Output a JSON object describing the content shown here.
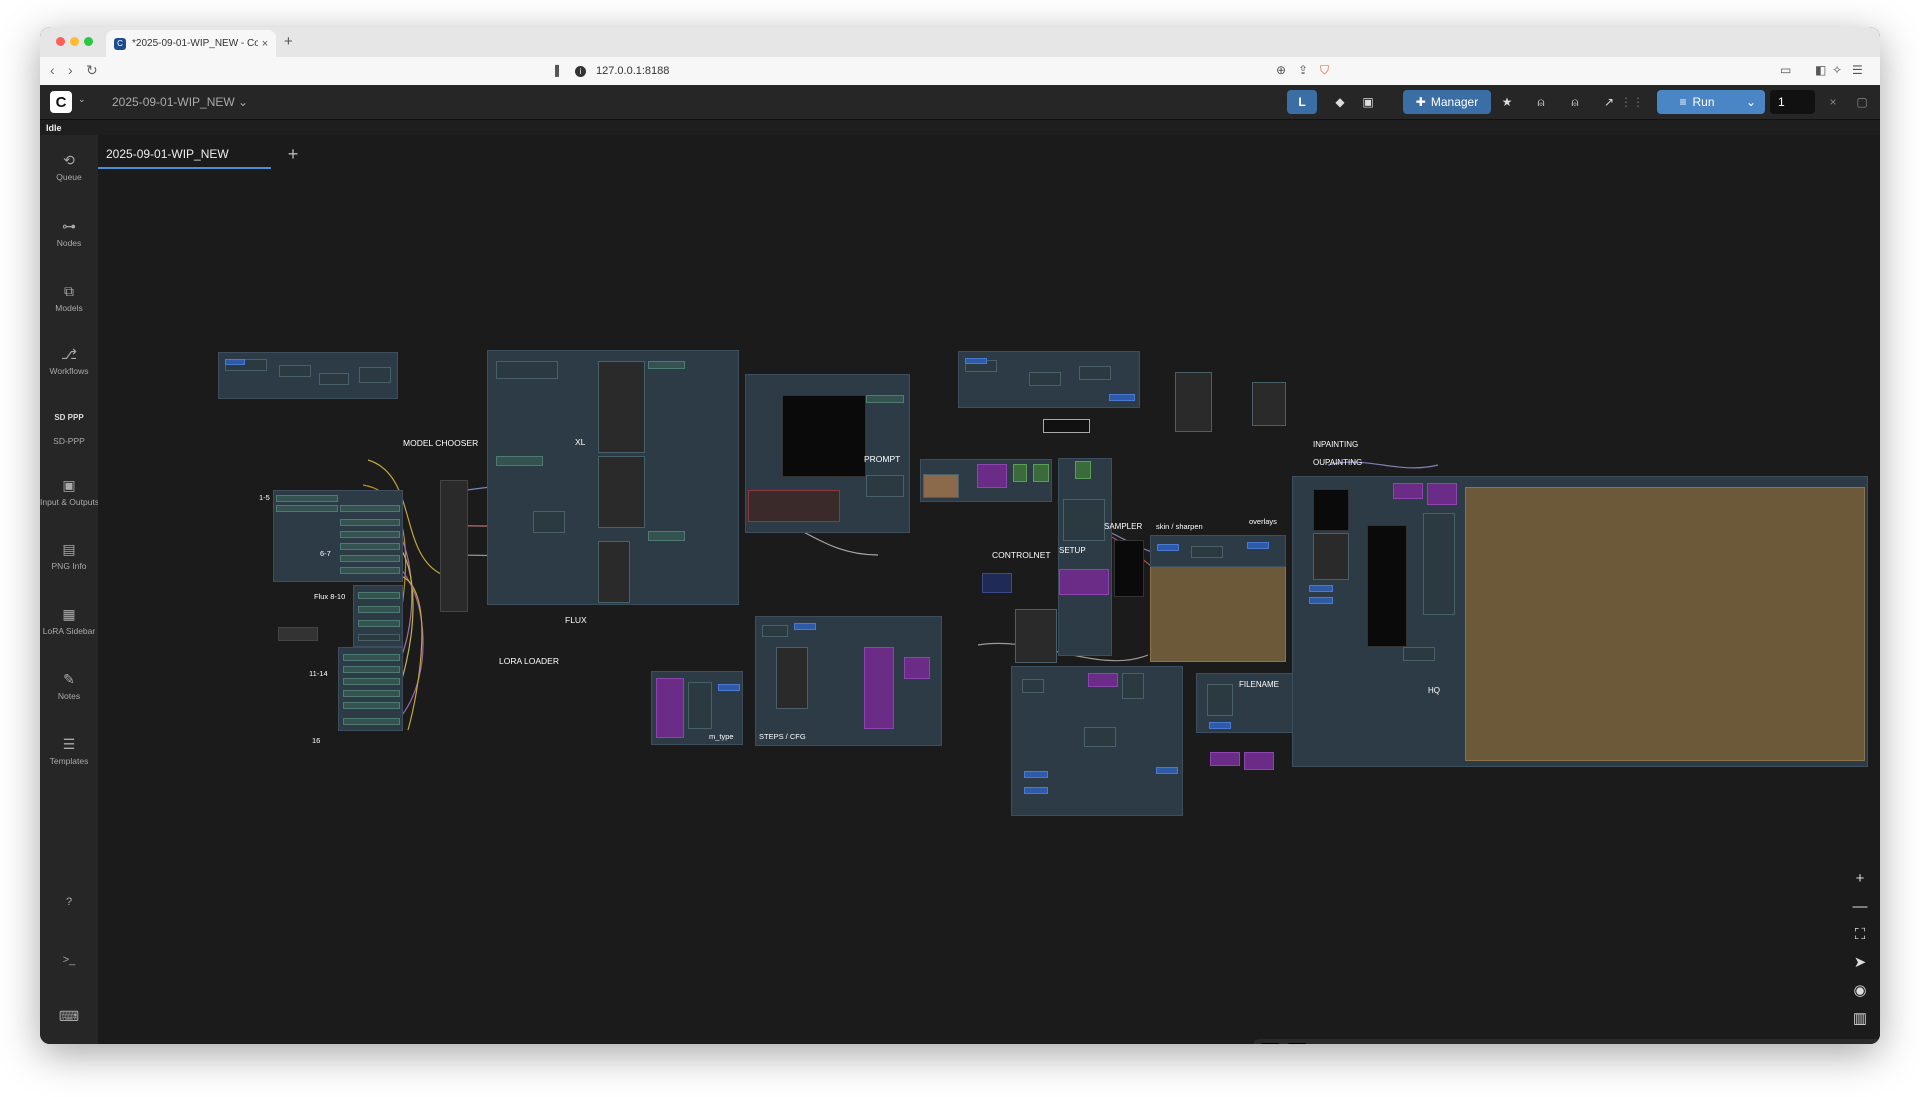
{
  "browser": {
    "tab_title": "*2025-09-01-WIP_NEW - Co",
    "tab_close": "×",
    "new_tab": "+",
    "url": "127.0.0.1:8188",
    "nav": {
      "back": "‹",
      "forward": "›",
      "reload": "↻"
    }
  },
  "app": {
    "logo": "C",
    "workflow_name": "2025-09-01-WIP_NEW ⌄",
    "status": "Idle",
    "toolbar": {
      "layout_badge": "L",
      "manager_label": "Manager",
      "run_label": "Run",
      "batch_count": "1",
      "close": "×"
    }
  },
  "sidebar": {
    "items": [
      {
        "label": "Queue",
        "icon": "history-icon",
        "glyph": "⟲"
      },
      {
        "label": "Nodes",
        "icon": "nodes-icon",
        "glyph": "⊶"
      },
      {
        "label": "Models",
        "icon": "models-icon",
        "glyph": "⧉"
      },
      {
        "label": "Workflows",
        "icon": "workflows-icon",
        "glyph": "⎇"
      },
      {
        "label": "SD-PPP",
        "icon": "sd-ppp-logo",
        "glyph": "SD PPP"
      },
      {
        "label": "Input & Outputs",
        "icon": "image-icon",
        "glyph": "▣"
      },
      {
        "label": "PNG Info",
        "icon": "png-info-icon",
        "glyph": "▤"
      },
      {
        "label": "LoRA Sidebar",
        "icon": "lora-icon",
        "glyph": "▦"
      },
      {
        "label": "Notes",
        "icon": "notes-icon",
        "glyph": "✎"
      },
      {
        "label": "Templates",
        "icon": "templates-icon",
        "glyph": "☰"
      }
    ],
    "bottom": [
      {
        "icon": "help-icon",
        "glyph": "?"
      },
      {
        "icon": "terminal-icon",
        "glyph": ">_"
      },
      {
        "icon": "keyboard-icon",
        "glyph": "⌨"
      }
    ]
  },
  "canvas": {
    "workflow_tab": "2025-09-01-WIP_NEW",
    "add_tab": "+",
    "group_labels": {
      "model_chooser": "MODEL CHOOSER",
      "xl": "XL",
      "g1_5": "1-5",
      "g6_7": "6-7",
      "flux_8_10": "Flux 8-10",
      "g11_14": "11-14",
      "g16": "16",
      "flux": "FLUX",
      "lora_loader": "LORA LOADER",
      "prompt": "PROMPT",
      "m_type": "m_type",
      "steps_cfg": "STEPS / CFG",
      "controlnet": "CONTROLNET",
      "setup": "SETUP",
      "sampler": "SAMPLER",
      "skin_sharpen": "skin / sharpen",
      "overlays": "overlays",
      "filename": "FILENAME",
      "inpainting": "INPAINTING",
      "oupainting": "OUPAINTING",
      "hq": "HQ"
    }
  },
  "zoom_controls": [
    "+",
    "—",
    "⛶",
    "➤",
    "◉",
    "▥"
  ],
  "selection_toolbar": [
    "⊢",
    "+",
    "⊣",
    "⊤",
    "⊹",
    "⊥",
    "⇔",
    "⇕",
    "▥",
    "≣",
    "⌐",
    "¬",
    "+",
    "⊏",
    "⊐",
    "⊓",
    "⊠",
    "×"
  ]
}
